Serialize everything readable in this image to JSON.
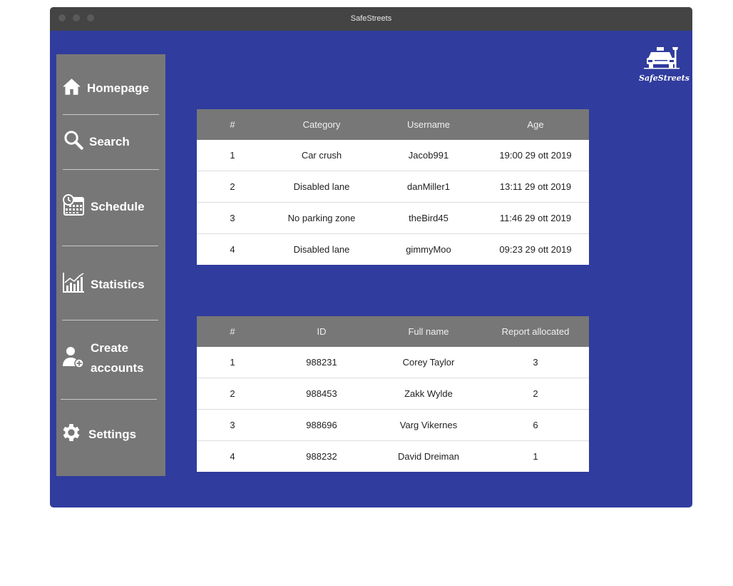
{
  "window": {
    "title": "SafeStreets"
  },
  "logo": {
    "text": "SafeStreets",
    "icon": "car-and-streetlight-icon"
  },
  "sidebar": {
    "items": [
      {
        "label": "Homepage",
        "icon": "home-icon"
      },
      {
        "label": "Search",
        "icon": "search-icon"
      },
      {
        "label": "Schedule",
        "icon": "calendar-clock-icon"
      },
      {
        "label": "Statistics",
        "icon": "chart-icon"
      },
      {
        "label": "Create accounts",
        "line1": "Create",
        "line2": "accounts",
        "icon": "add-user-icon"
      },
      {
        "label": "Settings",
        "icon": "gear-icon"
      }
    ]
  },
  "reports_table": {
    "headers": [
      "#",
      "Category",
      "Username",
      "Age"
    ],
    "rows": [
      [
        "1",
        "Car crush",
        "Jacob991",
        "19:00 29 ott 2019"
      ],
      [
        "2",
        "Disabled lane",
        "danMiller1",
        "13:11 29 ott 2019"
      ],
      [
        "3",
        "No parking zone",
        "theBird45",
        "11:46 29 ott 2019"
      ],
      [
        "4",
        "Disabled lane",
        "gimmyMoo",
        "09:23 29 ott 2019"
      ]
    ]
  },
  "accounts_table": {
    "headers": [
      "#",
      "ID",
      "Full name",
      "Report allocated"
    ],
    "rows": [
      [
        "1",
        "988231",
        "Corey Taylor",
        "3"
      ],
      [
        "2",
        "988453",
        "Zakk Wylde",
        "2"
      ],
      [
        "3",
        "988696",
        "Varg Vikernes",
        "6"
      ],
      [
        "4",
        "988232",
        "David Dreiman",
        "1"
      ]
    ]
  },
  "colors": {
    "background": "#303c9e",
    "sidebar": "#777777",
    "titlebar": "#444444",
    "table_header": "#777777"
  }
}
